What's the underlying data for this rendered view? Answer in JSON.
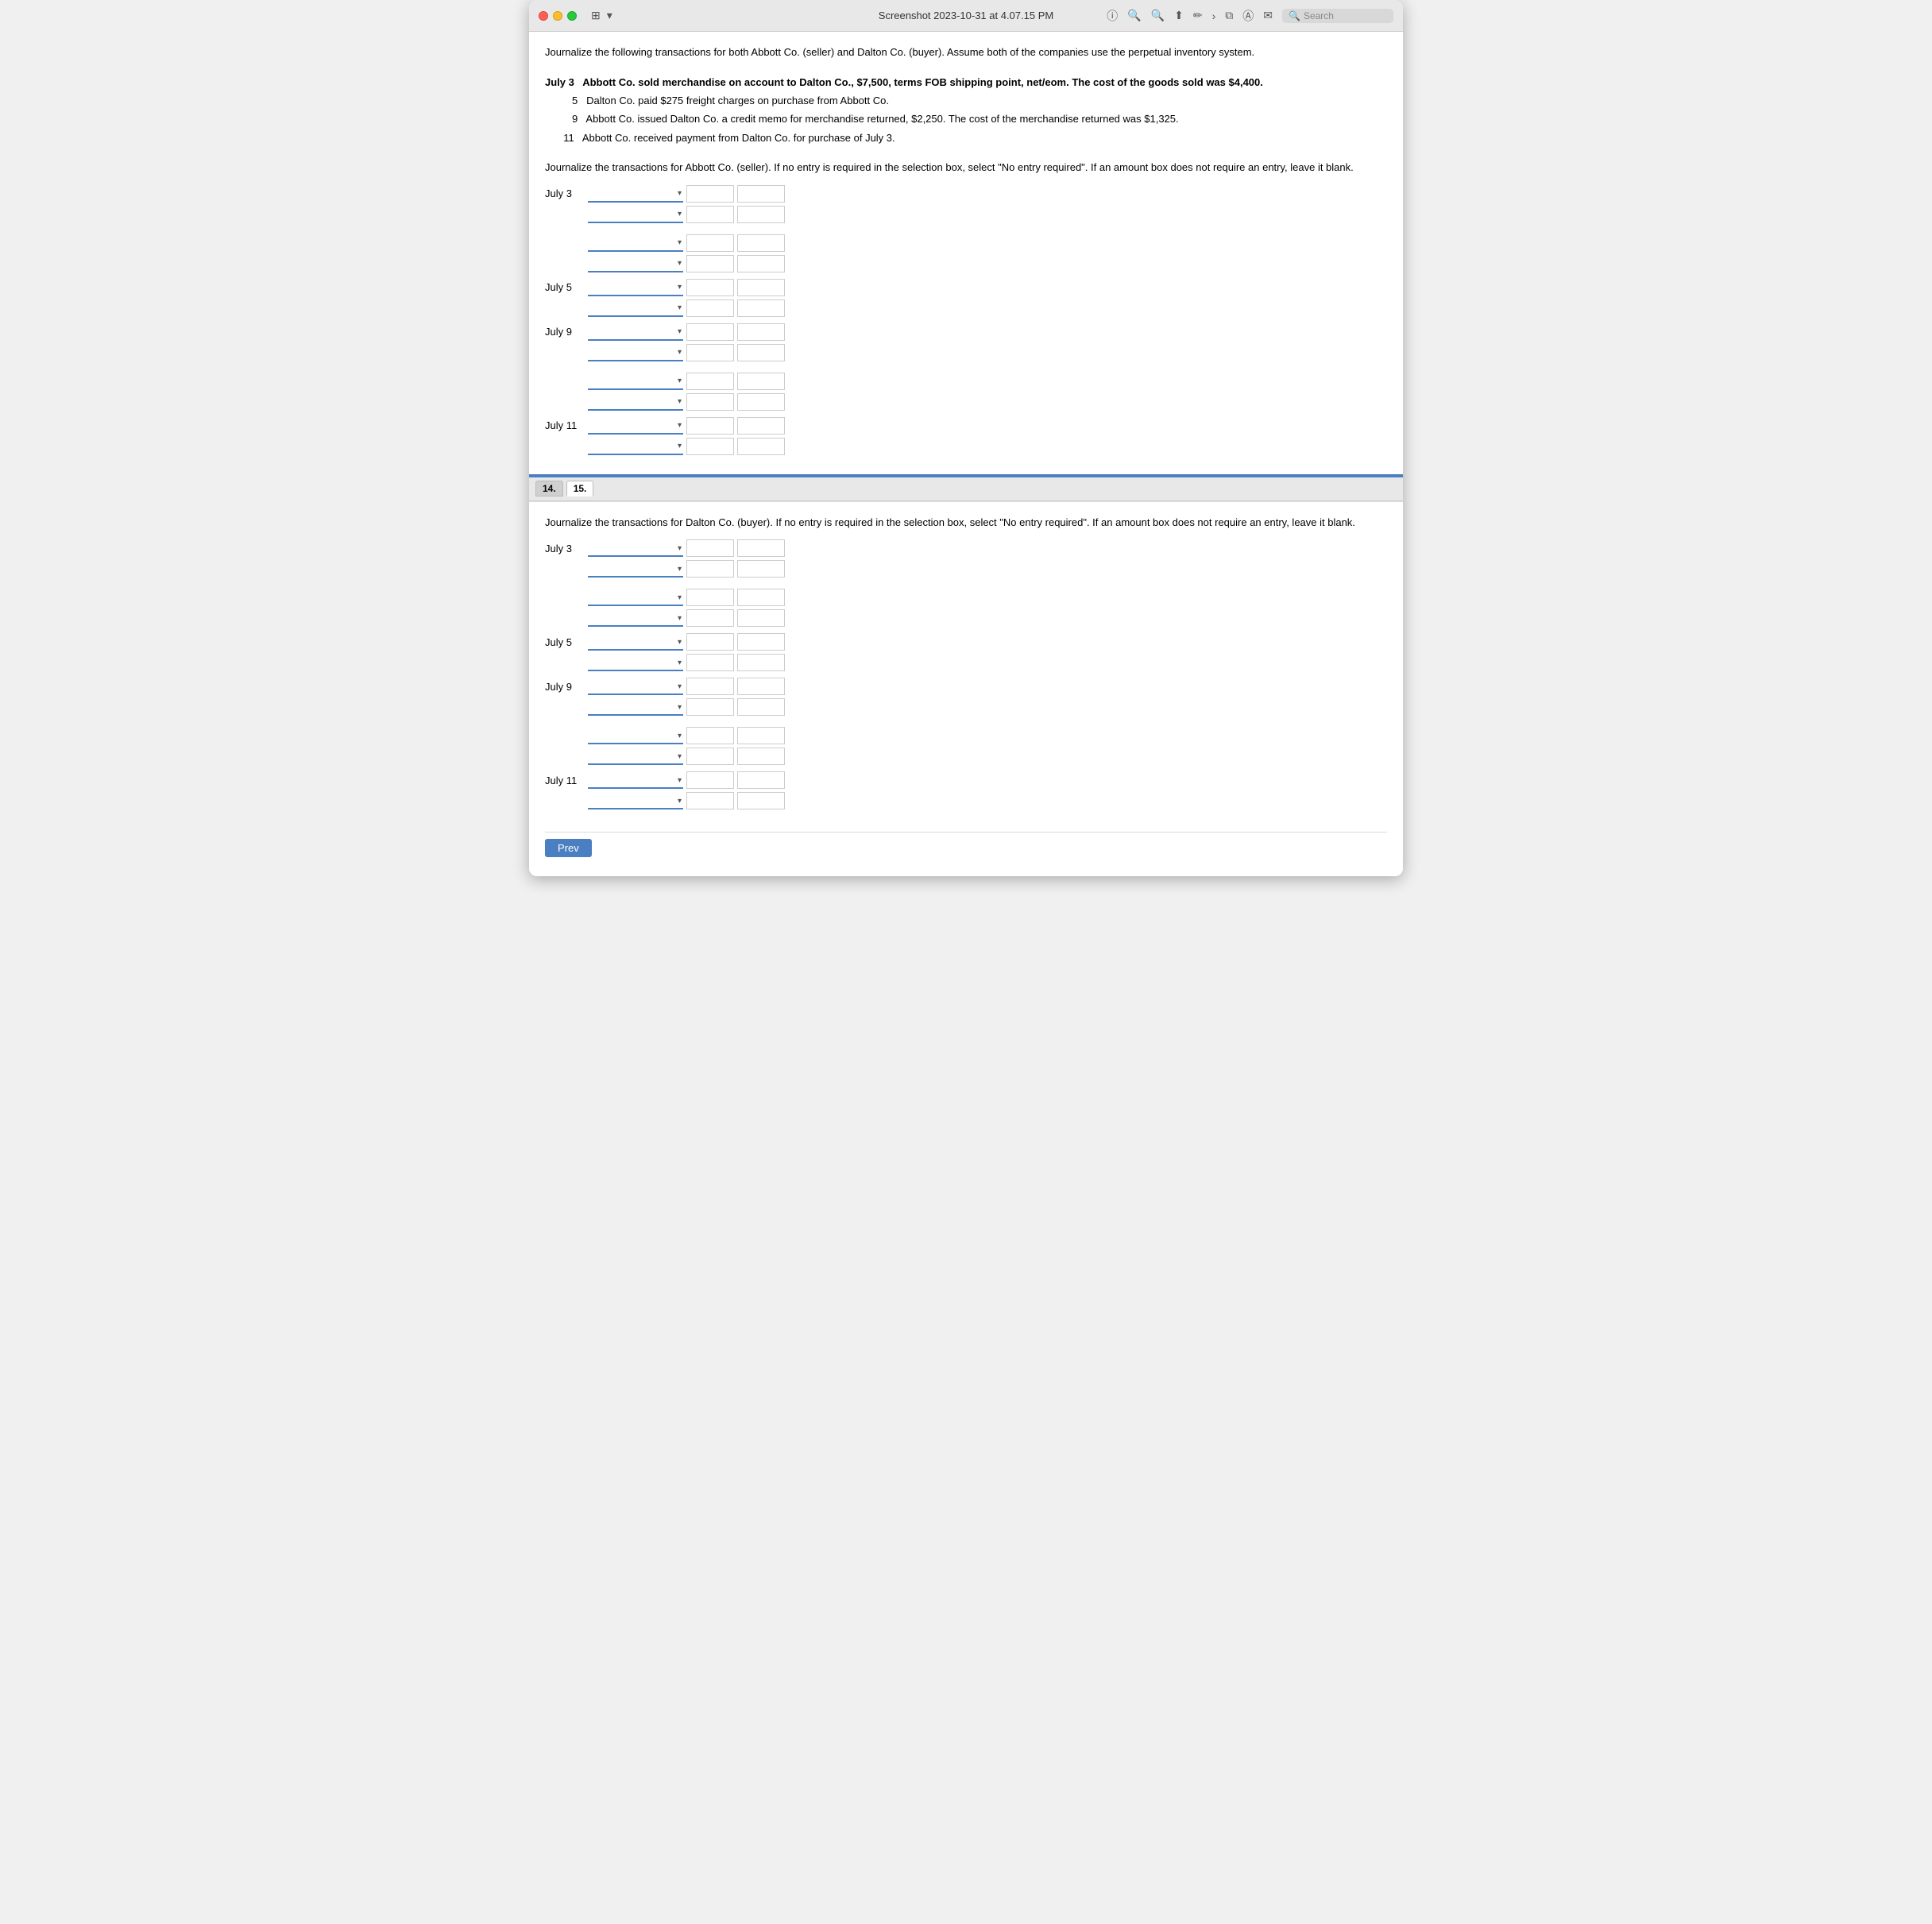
{
  "window": {
    "title": "Screenshot 2023-10-31 at 4.07.15 PM",
    "search_placeholder": "Search"
  },
  "intro": {
    "text": "Journalize the following transactions for both Abbott Co. (seller) and Dalton Co. (buyer). Assume both of the companies use the perpetual inventory system."
  },
  "transactions": [
    {
      "date": "July 3",
      "description": "Abbott Co. sold merchandise on account to Dalton Co., $7,500, terms FOB shipping point, net/eom. The cost of the goods sold was $4,400.",
      "bold": true
    },
    {
      "date": "5",
      "description": "Dalton Co. paid $275 freight charges on purchase from Abbott Co.",
      "bold": false
    },
    {
      "date": "9",
      "description": "Abbott Co. issued Dalton Co. a credit memo for merchandise returned, $2,250. The cost of the merchandise returned was $1,325.",
      "bold": false
    },
    {
      "date": "11",
      "description": "Abbott Co. received payment from Dalton Co. for purchase of July 3.",
      "bold": false
    }
  ],
  "section_abbott": {
    "instructions": "Journalize the transactions for Abbott Co. (seller). If no entry is required in the selection box, select \"No entry required\". If an amount box does not require an entry, leave it blank.",
    "entries": [
      {
        "date": "July 3",
        "rows": [
          {
            "type": "debit",
            "indented": false
          },
          {
            "type": "credit",
            "indented": true
          },
          {
            "type": "spacer"
          },
          {
            "type": "debit",
            "indented": false
          },
          {
            "type": "credit",
            "indented": true
          }
        ]
      },
      {
        "date": "July 5",
        "rows": [
          {
            "type": "debit",
            "indented": false
          },
          {
            "type": "credit",
            "indented": true
          }
        ]
      },
      {
        "date": "July 9",
        "rows": [
          {
            "type": "debit",
            "indented": false
          },
          {
            "type": "credit",
            "indented": true
          },
          {
            "type": "spacer"
          },
          {
            "type": "debit",
            "indented": false
          },
          {
            "type": "credit",
            "indented": true
          }
        ]
      },
      {
        "date": "July 11",
        "rows": [
          {
            "type": "debit",
            "indented": false
          },
          {
            "type": "credit",
            "indented": true
          }
        ]
      }
    ]
  },
  "section_dalton": {
    "instructions": "Journalize the transactions for Dalton Co. (buyer). If no entry is required in the selection box, select \"No entry required\". If an amount box does not require an entry, leave it blank.",
    "entries": [
      {
        "date": "July 3",
        "rows": [
          {
            "type": "debit",
            "indented": false
          },
          {
            "type": "credit",
            "indented": true
          },
          {
            "type": "spacer"
          },
          {
            "type": "debit",
            "indented": false
          },
          {
            "type": "credit",
            "indented": true
          }
        ]
      },
      {
        "date": "July 5",
        "rows": [
          {
            "type": "debit",
            "indented": false
          },
          {
            "type": "credit",
            "indented": true
          }
        ]
      },
      {
        "date": "July 9",
        "rows": [
          {
            "type": "debit",
            "indented": false
          },
          {
            "type": "credit",
            "indented": true
          },
          {
            "type": "spacer"
          },
          {
            "type": "debit",
            "indented": false
          },
          {
            "type": "credit",
            "indented": true
          }
        ]
      },
      {
        "date": "July 11",
        "rows": [
          {
            "type": "debit",
            "indented": false
          },
          {
            "type": "credit",
            "indented": true
          }
        ]
      }
    ]
  },
  "question_numbers": [
    "14.",
    "15."
  ],
  "prev_label": "Prev"
}
